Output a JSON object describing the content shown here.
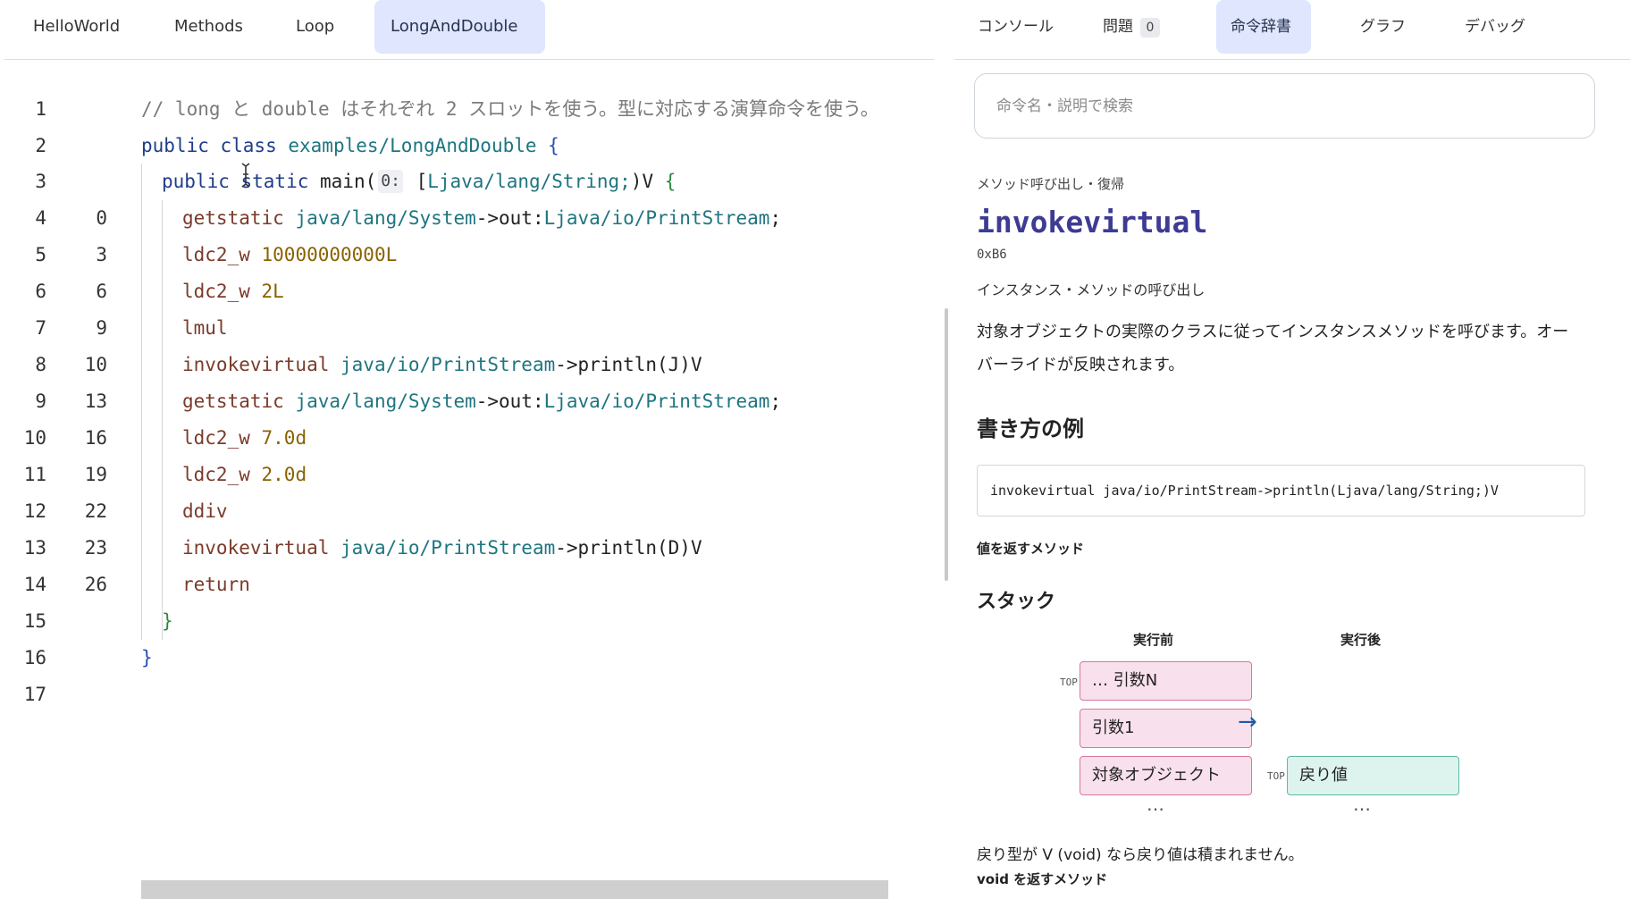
{
  "editor": {
    "tabs": [
      {
        "label": "HelloWorld",
        "active": false
      },
      {
        "label": "Methods",
        "active": false
      },
      {
        "label": "Loop",
        "active": false
      },
      {
        "label": "LongAndDouble",
        "active": true
      }
    ],
    "lines": [
      {
        "n": "1",
        "off": "",
        "tokens": [
          {
            "t": "// long と double はそれぞれ 2 スロットを使う。型に対応する演算命令を使う。",
            "c": "comment"
          }
        ]
      },
      {
        "n": "2",
        "off": "",
        "tokens": [
          {
            "t": "public class ",
            "c": "kw"
          },
          {
            "t": "examples/LongAndDouble",
            "c": "cls"
          },
          {
            "t": " {",
            "c": "brace"
          }
        ]
      },
      {
        "n": "3",
        "off": "",
        "tokens": [
          {
            "t": "public static ",
            "c": "kw"
          },
          {
            "t": "main(",
            "c": "plain"
          },
          {
            "t": "0:",
            "c": "hint"
          },
          {
            "t": " [",
            "c": "plain"
          },
          {
            "t": "Ljava/lang/String;",
            "c": "cls"
          },
          {
            "t": ")V ",
            "c": "plain"
          },
          {
            "t": "{",
            "c": "green"
          }
        ]
      },
      {
        "n": "4",
        "off": "0",
        "tokens": [
          {
            "t": "getstatic ",
            "c": "ins"
          },
          {
            "t": "java/lang/System",
            "c": "cls"
          },
          {
            "t": "->out:",
            "c": "plain"
          },
          {
            "t": "Ljava/io/PrintStream",
            "c": "cls"
          },
          {
            "t": ";",
            "c": "plain"
          }
        ]
      },
      {
        "n": "5",
        "off": "3",
        "tokens": [
          {
            "t": "ldc2_w ",
            "c": "ins"
          },
          {
            "t": "10000000000L",
            "c": "num"
          }
        ]
      },
      {
        "n": "6",
        "off": "6",
        "tokens": [
          {
            "t": "ldc2_w ",
            "c": "ins"
          },
          {
            "t": "2L",
            "c": "num"
          }
        ]
      },
      {
        "n": "7",
        "off": "9",
        "tokens": [
          {
            "t": "lmul",
            "c": "ins"
          }
        ]
      },
      {
        "n": "8",
        "off": "10",
        "tokens": [
          {
            "t": "invokevirtual ",
            "c": "ins"
          },
          {
            "t": "java/io/PrintStream",
            "c": "cls"
          },
          {
            "t": "->println(J)V",
            "c": "plain"
          }
        ]
      },
      {
        "n": "9",
        "off": "13",
        "tokens": [
          {
            "t": "getstatic ",
            "c": "ins"
          },
          {
            "t": "java/lang/System",
            "c": "cls"
          },
          {
            "t": "->out:",
            "c": "plain"
          },
          {
            "t": "Ljava/io/PrintStream",
            "c": "cls"
          },
          {
            "t": ";",
            "c": "plain"
          }
        ]
      },
      {
        "n": "10",
        "off": "16",
        "tokens": [
          {
            "t": "ldc2_w ",
            "c": "ins"
          },
          {
            "t": "7.0d",
            "c": "num"
          }
        ]
      },
      {
        "n": "11",
        "off": "19",
        "tokens": [
          {
            "t": "ldc2_w ",
            "c": "ins"
          },
          {
            "t": "2.0d",
            "c": "num"
          }
        ]
      },
      {
        "n": "12",
        "off": "22",
        "tokens": [
          {
            "t": "ddiv",
            "c": "ins"
          }
        ]
      },
      {
        "n": "13",
        "off": "23",
        "tokens": [
          {
            "t": "invokevirtual ",
            "c": "ins"
          },
          {
            "t": "java/io/PrintStream",
            "c": "cls"
          },
          {
            "t": "->println(D)V",
            "c": "plain"
          }
        ]
      },
      {
        "n": "14",
        "off": "26",
        "tokens": [
          {
            "t": "return",
            "c": "ins"
          }
        ]
      },
      {
        "n": "15",
        "off": "",
        "tokens": [
          {
            "t": "}",
            "c": "green"
          }
        ]
      },
      {
        "n": "16",
        "off": "",
        "tokens": [
          {
            "t": "}",
            "c": "brace"
          }
        ]
      },
      {
        "n": "17",
        "off": "",
        "tokens": []
      }
    ]
  },
  "panel": {
    "tabs": [
      {
        "label": "コンソール",
        "active": false
      },
      {
        "label": "問題",
        "active": false,
        "badge": "0"
      },
      {
        "label": "命令辞書",
        "active": true
      },
      {
        "label": "グラフ",
        "active": false
      },
      {
        "label": "デバッグ",
        "active": false
      }
    ],
    "search_placeholder": "命令名・説明で検索",
    "category": "メソッド呼び出し・復帰",
    "instruction": "invokevirtual",
    "opcode": "0xB6",
    "summary": "インスタンス・メソッドの呼び出し",
    "description": "対象オブジェクトの実際のクラスに従ってインスタンスメソッドを呼びます。オーバーライドが反映されます。",
    "example_heading": "書き方の例",
    "example_code": "invokevirtual java/io/PrintStream->println(Ljava/lang/String;)V",
    "return_note": "値を返すメソッド",
    "stack_heading": "スタック",
    "stack_before_label": "実行前",
    "stack_after_label": "実行後",
    "top_label": "TOP",
    "stack_before": [
      "… 引数N",
      "引数1",
      "対象オブジェクト"
    ],
    "stack_after": [
      "戻り値"
    ],
    "arrow": "→",
    "ellipsis": "…",
    "footnote": "戻り型が V (void) なら戻り値は積まれません。",
    "void_heading": "void を返すメソッド",
    "colors": {
      "accent_tab": "#dfe6fd",
      "stack_before": "#f8e0ec",
      "stack_after": "#ddf3ee",
      "instruction": "#3d3b93"
    }
  }
}
